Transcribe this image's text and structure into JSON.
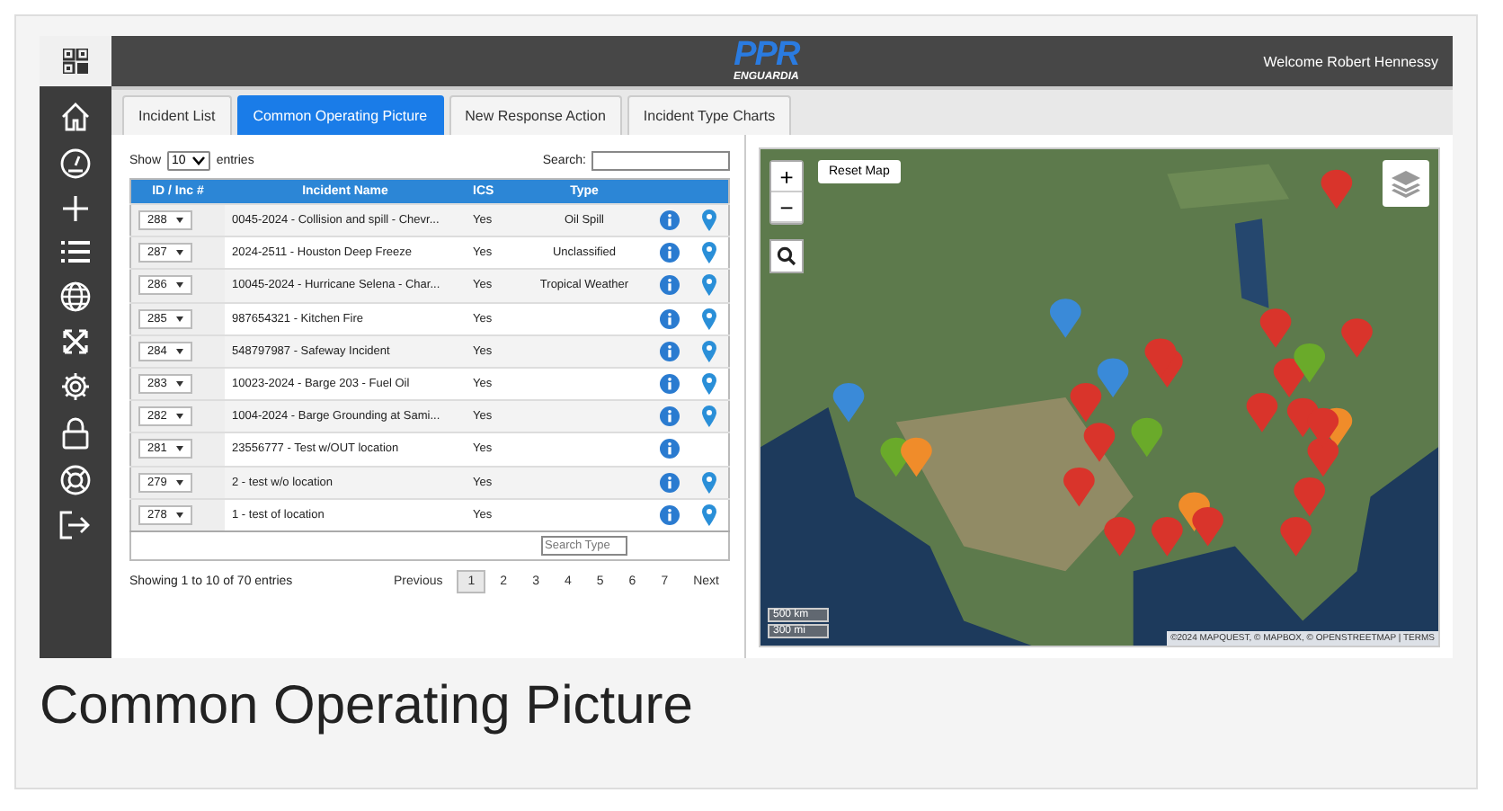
{
  "header": {
    "logo": "PPR",
    "logo_sub": "ENGUARDIA",
    "welcome": "Welcome Robert Hennessy"
  },
  "tabs": [
    {
      "label": "Incident List",
      "selected": false
    },
    {
      "label": "Common Operating Picture",
      "selected": true
    },
    {
      "label": "New Response Action",
      "selected": false
    },
    {
      "label": "Incident Type Charts",
      "selected": false
    }
  ],
  "table_controls": {
    "show_label": "Show",
    "page_size": "10",
    "entries_label": "entries",
    "search_label": "Search:"
  },
  "table": {
    "columns": [
      "ID / Inc #",
      "Incident Name",
      "ICS",
      "Type"
    ],
    "rows": [
      {
        "id": "288",
        "name": "0045-2024 - Collision and spill - Chevr...",
        "ics": "Yes",
        "type": "Oil Spill",
        "has_location": true
      },
      {
        "id": "287",
        "name": "2024-2511 - Houston Deep Freeze",
        "ics": "Yes",
        "type": "Unclassified",
        "has_location": true
      },
      {
        "id": "286",
        "name": "10045-2024 - Hurricane Selena - Char...",
        "ics": "Yes",
        "type": "Tropical Weather",
        "has_location": true
      },
      {
        "id": "285",
        "name": "987654321 - Kitchen Fire",
        "ics": "Yes",
        "type": "",
        "has_location": true
      },
      {
        "id": "284",
        "name": "548797987 - Safeway Incident",
        "ics": "Yes",
        "type": "",
        "has_location": true
      },
      {
        "id": "283",
        "name": "10023-2024 - Barge 203 - Fuel Oil",
        "ics": "Yes",
        "type": "",
        "has_location": true
      },
      {
        "id": "282",
        "name": "1004-2024 - Barge Grounding at Sami...",
        "ics": "Yes",
        "type": "",
        "has_location": true
      },
      {
        "id": "281",
        "name": "23556777 - Test w/OUT location",
        "ics": "Yes",
        "type": "",
        "has_location": false
      },
      {
        "id": "279",
        "name": "2 - test w/o location",
        "ics": "Yes",
        "type": "",
        "has_location": true
      },
      {
        "id": "278",
        "name": "1 - test of location",
        "ics": "Yes",
        "type": "",
        "has_location": true
      }
    ],
    "type_filter_placeholder": "Search Type"
  },
  "pagination": {
    "info": "Showing 1 to 10 of 70 entries",
    "previous": "Previous",
    "next": "Next",
    "pages": [
      {
        "label": "1",
        "selected": true
      },
      {
        "label": "2",
        "selected": false
      },
      {
        "label": "3",
        "selected": false
      },
      {
        "label": "4",
        "selected": false
      },
      {
        "label": "5",
        "selected": false
      },
      {
        "label": "6",
        "selected": false
      },
      {
        "label": "7",
        "selected": false
      }
    ]
  },
  "map": {
    "zoom_in": "+",
    "zoom_out": "−",
    "reset": "Reset Map",
    "scale_km": "500 km",
    "scale_mi": "300 mi",
    "attribution": "©2024 MAPQUEST, © MAPBOX, © OPENSTREETMAP | TERMS"
  },
  "caption": "Common Operating Picture"
}
